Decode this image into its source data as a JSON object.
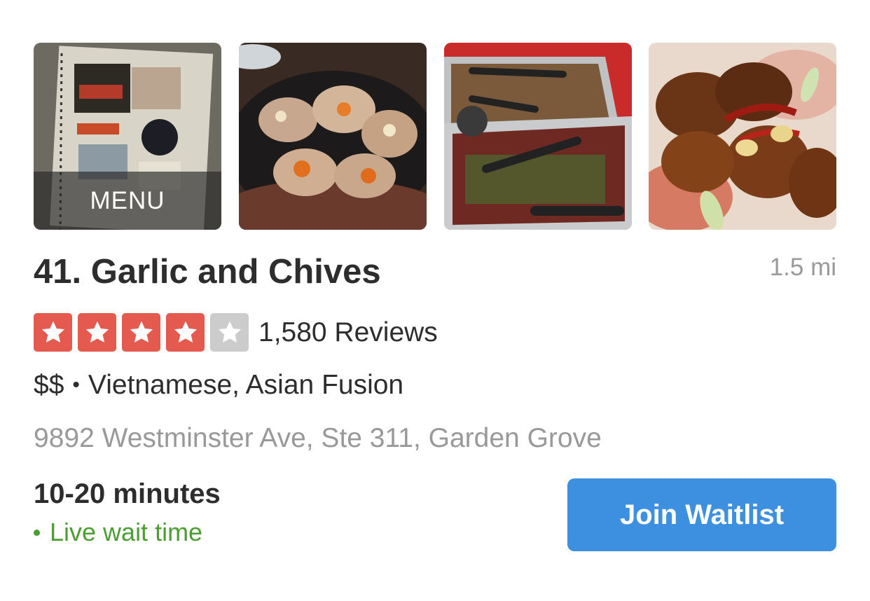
{
  "photos": {
    "menu_label": "MENU",
    "items": [
      "menu-photo",
      "scallops-photo",
      "catering-trays-photo",
      "chicken-wings-photo"
    ]
  },
  "business": {
    "title": "41. Garlic and Chives",
    "distance": "1.5 mi",
    "rating": 4,
    "rating_max": 5,
    "reviews": "1,580 Reviews",
    "price": "$$",
    "separator": "•",
    "categories": "Vietnamese, Asian Fusion",
    "address": "9892 Westminster Ave, Ste 311, Garden Grove"
  },
  "waitlist": {
    "wait_time": "10-20 minutes",
    "live_label": "Live wait time",
    "button_label": "Join Waitlist"
  },
  "colors": {
    "star_on": "#e45a4f",
    "star_off": "#cccccc",
    "button": "#3d8fe0",
    "live": "#4c9d32"
  },
  "icons": {
    "star": "star-icon",
    "live_dot": "live-dot-icon"
  }
}
